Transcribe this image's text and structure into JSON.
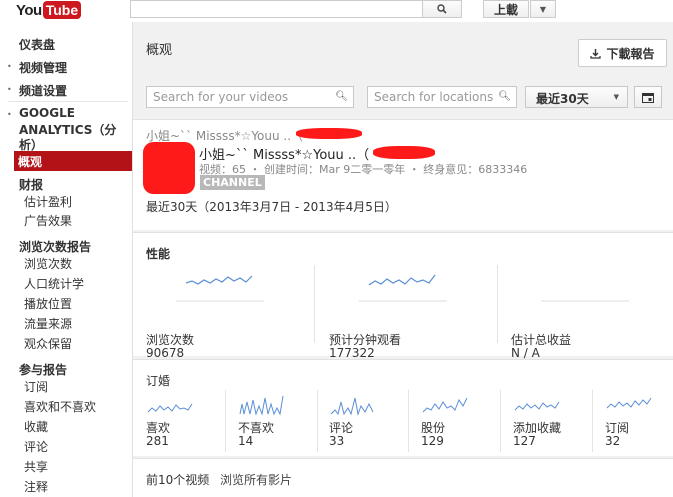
{
  "topbar": {
    "logo_you": "You",
    "logo_tube": "Tube",
    "search_value": "",
    "upload_label": "上載"
  },
  "sidebar": {
    "items": [
      {
        "label": "仪表盘",
        "bold": true
      },
      {
        "label": "视频管理",
        "bold": true,
        "bullet": true
      },
      {
        "label": "频道设置",
        "bold": true,
        "bullet": true
      },
      {
        "label": "GOOGLE ANALYTICS（分析）",
        "bold": true,
        "bullet": true
      },
      {
        "label": "概观",
        "active": true
      },
      {
        "label": "财报",
        "bold": true
      },
      {
        "label": "估计盈利"
      },
      {
        "label": "广告效果"
      },
      {
        "label": "浏览次数报告",
        "bold": true
      },
      {
        "label": "浏览次数"
      },
      {
        "label": "人口统计学"
      },
      {
        "label": "播放位置"
      },
      {
        "label": "流量来源"
      },
      {
        "label": "观众保留"
      },
      {
        "label": "参与报告",
        "bold": true
      },
      {
        "label": "订阅"
      },
      {
        "label": "喜欢和不喜欢"
      },
      {
        "label": "收藏"
      },
      {
        "label": "评论"
      },
      {
        "label": "共享"
      },
      {
        "label": "注释"
      }
    ],
    "ga_line1": "GOOGLE",
    "ga_line2": "ANALYTICS（分",
    "ga_line3": "析）"
  },
  "main": {
    "title": "概观",
    "download_label": "下載報告",
    "search_videos_placeholder": "Search for your videos",
    "search_locations_placeholder": "Search for locations",
    "range_label": "最近30天"
  },
  "channel": {
    "top_line": "小姐~`` Missss*☆Youu ..（",
    "name": "小姐~`` Missss*☆Youu ..（",
    "meta": "视频：65 ・ 创建时间：Mar 9二零一零年 ・ 终身意见：6833346",
    "badge": "CHANNEL",
    "range": "最近30天（2013年3月7日 - 2013年4月5日）"
  },
  "performance": {
    "title": "性能",
    "metrics": [
      {
        "label": "浏览次数",
        "value": "90678"
      },
      {
        "label": "预计分钟观看",
        "value": "177322"
      },
      {
        "label": "估计总收益",
        "value": "N / A"
      }
    ]
  },
  "subscriptions": {
    "title": "订婚",
    "metrics": [
      {
        "label": "喜欢",
        "value": "281"
      },
      {
        "label": "不喜欢",
        "value": "14"
      },
      {
        "label": "评论",
        "value": "33"
      },
      {
        "label": "股份",
        "value": "129"
      },
      {
        "label": "添加收藏",
        "value": "127"
      },
      {
        "label": "订阅",
        "value": "32"
      }
    ]
  },
  "top_videos": {
    "title": "前10个视频",
    "browse_label": "浏览所有影片"
  },
  "colors": {
    "brand_red": "#cc181e",
    "active_bg": "#b31217",
    "sparkline": "#5b8fd6",
    "redaction": "#ff1a1a"
  }
}
